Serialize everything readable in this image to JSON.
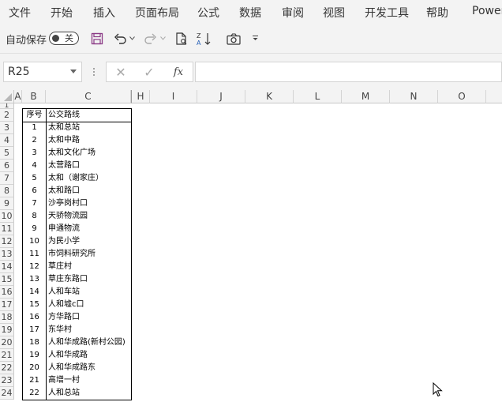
{
  "ribbon": {
    "tabs": [
      "文件",
      "开始",
      "插入",
      "页面布局",
      "公式",
      "数据",
      "审阅",
      "视图",
      "开发工具",
      "帮助",
      "Power"
    ]
  },
  "qat": {
    "autosave_label": "自动保存",
    "autosave_state": "关",
    "icons": [
      "save-icon",
      "undo-icon",
      "redo-icon",
      "print-preview-icon",
      "sort-az-icon",
      "camera-icon",
      "customize-qat-icon"
    ]
  },
  "formula_bar": {
    "name_box": "R25",
    "cancel_glyph": "✕",
    "enter_glyph": "✓",
    "fx_label": "fx",
    "formula": ""
  },
  "grid": {
    "columns": [
      "A",
      "B",
      "C",
      "H",
      "I",
      "J",
      "K",
      "L",
      "M",
      "N",
      "O"
    ],
    "rows": [
      "1",
      "2",
      "3",
      "4",
      "5",
      "6",
      "7",
      "8",
      "9",
      "10",
      "11",
      "12",
      "13",
      "14",
      "15",
      "16",
      "17",
      "18",
      "19",
      "20",
      "21",
      "22",
      "23",
      "24"
    ]
  },
  "table": {
    "header_no": "序号",
    "header_route": "公交路线",
    "rows": [
      {
        "no": "1",
        "name": "太和总站"
      },
      {
        "no": "2",
        "name": "太和中路"
      },
      {
        "no": "3",
        "name": "太和文化广场"
      },
      {
        "no": "4",
        "name": "太营路口"
      },
      {
        "no": "5",
        "name": "太和（谢家庄）"
      },
      {
        "no": "6",
        "name": "太和路口"
      },
      {
        "no": "7",
        "name": "沙亭岗村口"
      },
      {
        "no": "8",
        "name": "天骄物流园"
      },
      {
        "no": "9",
        "name": "申通物流"
      },
      {
        "no": "10",
        "name": "为民小学"
      },
      {
        "no": "11",
        "name": "市饲料研究所"
      },
      {
        "no": "12",
        "name": "草庄村"
      },
      {
        "no": "13",
        "name": "草庄东路口"
      },
      {
        "no": "14",
        "name": "人和车站"
      },
      {
        "no": "15",
        "name": "人和墟c口"
      },
      {
        "no": "16",
        "name": "方华路口"
      },
      {
        "no": "17",
        "name": "东华村"
      },
      {
        "no": "18",
        "name": "人和华成路(新村公园)"
      },
      {
        "no": "19",
        "name": "人和华成路"
      },
      {
        "no": "20",
        "name": "人和华成路东"
      },
      {
        "no": "21",
        "name": "高增一村"
      },
      {
        "no": "22",
        "name": "人和总站"
      }
    ]
  }
}
